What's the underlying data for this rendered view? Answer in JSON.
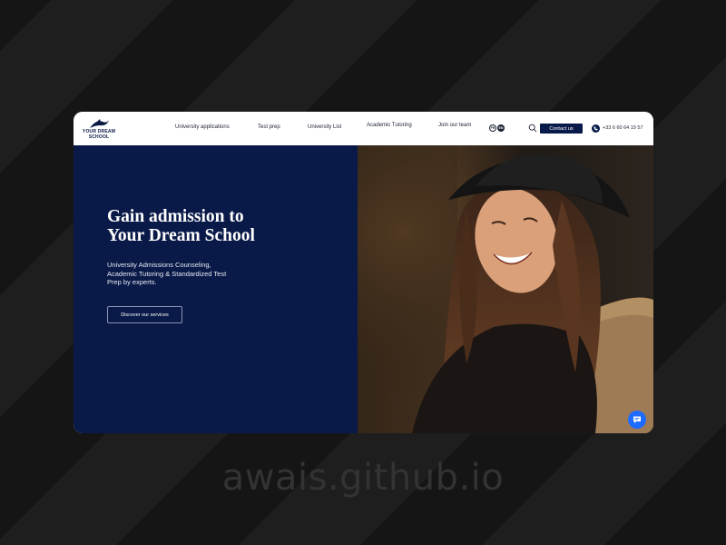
{
  "brand": {
    "name_line1": "YOUR DREAM",
    "name_line2": "SCHOOL",
    "accent": "#081a4a"
  },
  "nav": {
    "links": [
      "University applications",
      "Test prep",
      "University List",
      "Academic Tutoring",
      "Join our team"
    ],
    "lang_fr": "FR",
    "lang_en": "EN",
    "search_icon": "search-icon",
    "contact_label": "Contact us",
    "phone_icon": "phone-icon",
    "phone": "+33 6 60 64 19 57"
  },
  "hero": {
    "title_line1": "Gain admission to",
    "title_line2": "Your Dream School",
    "subtitle": "University Admissions Counseling, Academic Tutoring & Standardized Test Prep by experts.",
    "cta_label": "Discover our services",
    "background": "#0a1a48"
  },
  "chat": {
    "icon": "chat-icon",
    "color": "#1e6bff"
  },
  "watermark": "awais.github.io"
}
